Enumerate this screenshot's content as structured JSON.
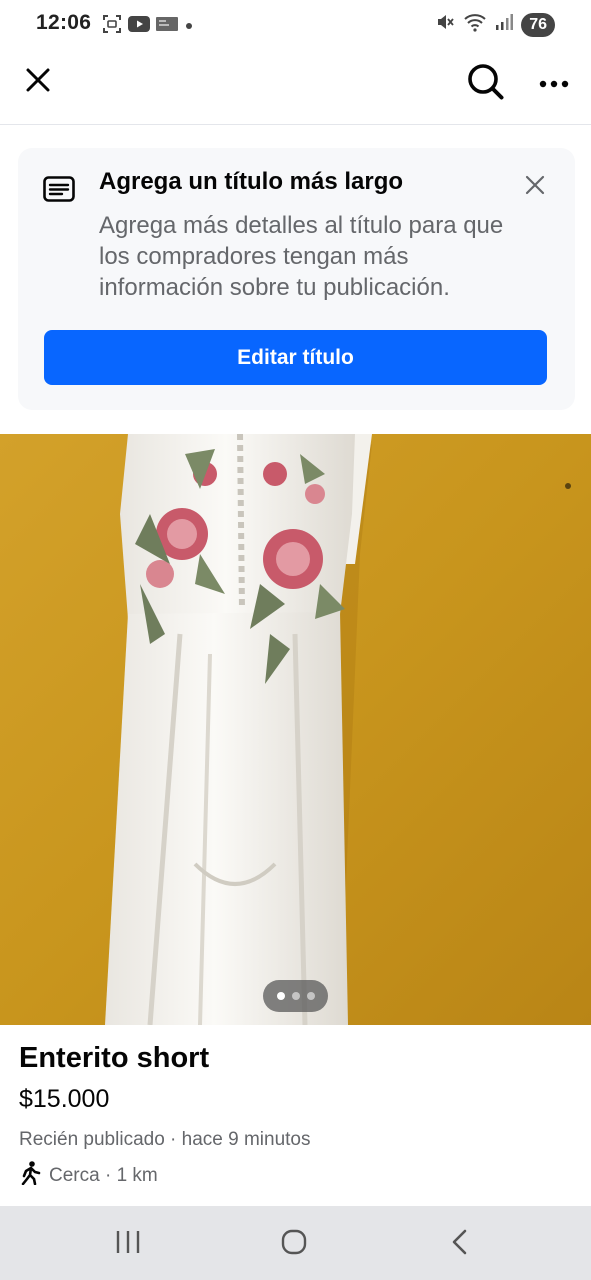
{
  "status_bar": {
    "time": "12:06",
    "battery": "76",
    "left_icons": [
      "screenshot-icon",
      "youtube-icon",
      "cast-icon",
      "notification-dot-icon"
    ],
    "right_icons": [
      "mute-icon",
      "wifi-icon",
      "signal-icon"
    ]
  },
  "app_bar": {
    "icons": [
      "close-icon",
      "search-icon",
      "more-icon"
    ]
  },
  "tip_card": {
    "icon": "title-text-icon",
    "title": "Agrega un título más largo",
    "body": "Agrega más detalles al título para que los compradores tengan más información sobre tu publicación.",
    "button_label": "Editar título",
    "accent_color": "#0866ff"
  },
  "photo": {
    "subject": "white-jumpsuit-with-floral-embroidery",
    "background_color": "#c9961e",
    "pages": 3,
    "current_page": 1
  },
  "listing": {
    "title": "Enterito short",
    "price": "$15.000",
    "posted": "Recién publicado · hace 9 minutos",
    "location": "Cerca · 1 km",
    "location_icon": "walking-person-icon"
  },
  "nav_bar": {
    "icons": [
      "recents-icon",
      "home-icon",
      "back-icon"
    ]
  }
}
